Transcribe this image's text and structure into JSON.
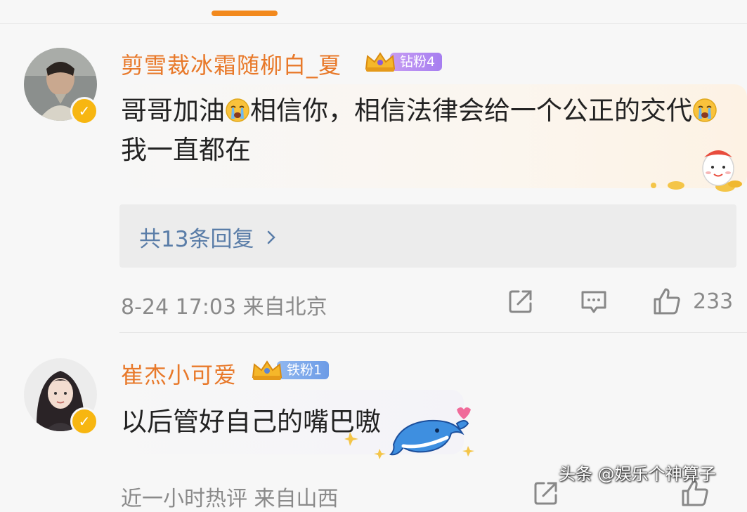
{
  "comments": [
    {
      "username": "剪雪裁冰霜随柳白_夏",
      "fan_badge": "钻粉4",
      "text_parts": [
        "哥哥加油",
        "相信你，相信法律会给一个公正的交代",
        "我一直都在"
      ],
      "replies_link": "共13条回复",
      "meta": "8-24 17:03 来自北京",
      "like_count": "233"
    },
    {
      "username": "崔杰小可爱",
      "fan_badge": "铁粉1",
      "text": "以后管好自己的嘴巴嗷",
      "meta": "近一小时热评 来自山西"
    }
  ],
  "watermark": "头条 @娱乐个神算子",
  "colors": {
    "accent": "#f2891d",
    "username": "#e8792a",
    "link": "#5a7da8",
    "meta": "#8a8a8a",
    "diamond_badge": "#a67ef0",
    "iron_badge": "#6c9be6",
    "verified": "#f7b611"
  },
  "icons": [
    "verified-badge-icon",
    "crown-icon",
    "crying-emoji-icon",
    "chevron-right-icon",
    "share-icon",
    "comment-icon",
    "like-icon"
  ]
}
